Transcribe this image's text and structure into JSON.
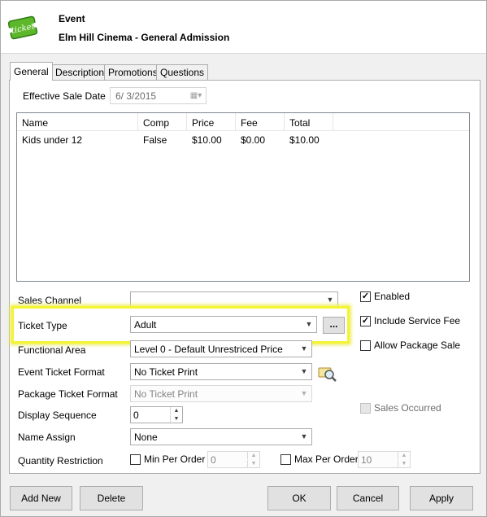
{
  "header": {
    "title": "Event",
    "subtitle": "Elm Hill Cinema - General Admission",
    "logo_text": "ticket"
  },
  "tabs": [
    {
      "label": "General"
    },
    {
      "label": "Description"
    },
    {
      "label": "Promotions"
    },
    {
      "label": "Questions"
    }
  ],
  "form": {
    "effective_sale_date_label": "Effective Sale Date",
    "effective_sale_date_value": "6/ 3/2015",
    "grid": {
      "columns": [
        "Name",
        "Comp",
        "Price",
        "Fee",
        "Total"
      ],
      "rows": [
        [
          "Kids under 12",
          "False",
          "$10.00",
          "$0.00",
          "$10.00"
        ]
      ]
    },
    "sales_channel_label": "Sales Channel",
    "sales_channel_value": "",
    "ticket_type_label": "Ticket Type",
    "ticket_type_value": "Adult",
    "ticket_type_browse": "...",
    "functional_area_label": "Functional Area",
    "functional_area_value": "Level 0 - Default Unrestriced Price",
    "event_ticket_format_label": "Event Ticket Format",
    "event_ticket_format_value": "No Ticket Print",
    "package_ticket_format_label": "Package Ticket Format",
    "package_ticket_format_value": "No Ticket Print",
    "display_sequence_label": "Display Sequence",
    "display_sequence_value": "0",
    "name_assign_label": "Name Assign",
    "name_assign_value": "None",
    "quantity_restriction_label": "Quantity Restriction",
    "min_per_order_label": "Min Per Order",
    "min_per_order_value": "0",
    "max_per_order_label": "Max Per Order",
    "max_per_order_value": "10",
    "enabled_label": "Enabled",
    "include_service_fee_label": "Include Service Fee",
    "allow_package_sale_label": "Allow Package Sale",
    "sales_occurred_label": "Sales Occurred"
  },
  "buttons": {
    "add_new": "Add New",
    "delete": "Delete",
    "ok": "OK",
    "cancel": "Cancel",
    "apply": "Apply"
  },
  "colors": {
    "highlight": "#f4f434",
    "logo_green": "#5cb82a"
  }
}
